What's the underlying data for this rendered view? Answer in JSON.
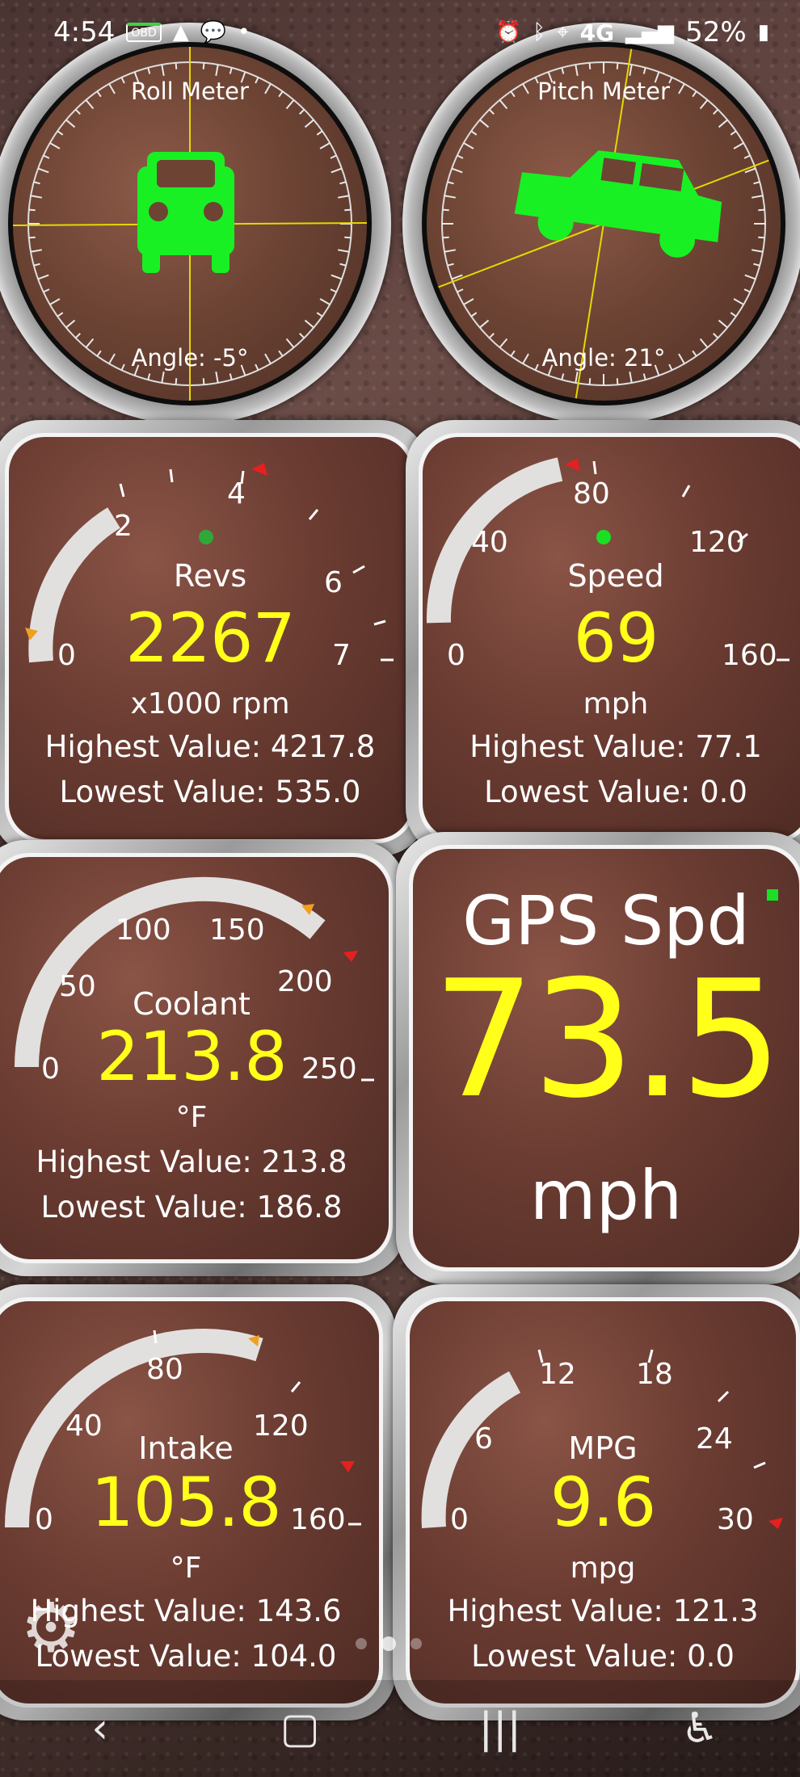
{
  "status_bar": {
    "time": "4:54",
    "left_icons": [
      "obd-icon",
      "navigation-arrow-icon",
      "wechat-icon",
      "dot-icon"
    ],
    "obd_label": "OBD",
    "right_icons": [
      "alarm-icon",
      "bluetooth-icon",
      "location-icon",
      "signal-icon"
    ],
    "network": "4G",
    "battery": "52%"
  },
  "roll_meter": {
    "title": "Roll Meter",
    "angle_text": "Angle: -5°",
    "angle_deg": -5
  },
  "pitch_meter": {
    "title": "Pitch Meter",
    "angle_text": "Angle: 21°",
    "angle_deg": 21
  },
  "revs": {
    "name": "Revs",
    "value": "2267",
    "unit": "x1000 rpm",
    "highest": "Highest Value: 4217.8",
    "lowest": "Lowest Value: 535.0",
    "scale": [
      "0",
      "2",
      "4",
      "6",
      "7"
    ]
  },
  "speed": {
    "name": "Speed",
    "value": "69",
    "unit": "mph",
    "highest": "Highest Value: 77.1",
    "lowest": "Lowest Value: 0.0",
    "scale": [
      "0",
      "40",
      "80",
      "120",
      "160"
    ]
  },
  "coolant": {
    "name": "Coolant",
    "value": "213.8",
    "unit": "°F",
    "highest": "Highest Value: 213.8",
    "lowest": "Lowest Value: 186.8",
    "scale": [
      "0",
      "50",
      "100",
      "150",
      "200",
      "250"
    ]
  },
  "gps": {
    "title": "GPS Spd",
    "value": "73.5",
    "unit": "mph"
  },
  "intake": {
    "name": "Intake",
    "value": "105.8",
    "unit": "°F",
    "highest": "Highest Value: 143.6",
    "lowest": "Lowest Value: 104.0",
    "scale": [
      "0",
      "40",
      "80",
      "120",
      "160"
    ]
  },
  "mpg": {
    "name": "MPG",
    "value": "9.6",
    "unit": "mpg",
    "highest": "Highest Value: 121.3",
    "lowest": "Lowest Value: 0.0",
    "scale": [
      "0",
      "6",
      "12",
      "18",
      "24",
      "30"
    ]
  },
  "nav": {
    "back": "back-icon",
    "home": "home-icon",
    "recents": "recents-icon",
    "accessibility": "accessibility-icon"
  },
  "colors": {
    "value_yellow": "#ffff1a",
    "car_green": "#19f023",
    "crosshair": "#e6d800",
    "arc_fill": "#e2e0df"
  }
}
